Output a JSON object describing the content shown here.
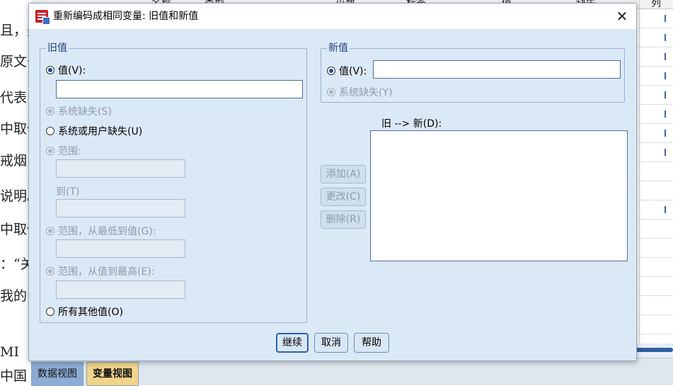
{
  "background": {
    "doc_lines": [
      "且，美",
      "原文书",
      "代表",
      "中取代",
      "戒烟",
      "说明。",
      "中取代",
      "：“关",
      "我的",
      "MI",
      "中国"
    ],
    "grid_headers": [
      "名称",
      "类型",
      "小数",
      "标签",
      "值",
      "缺失",
      "列"
    ],
    "tabs": {
      "data_view": "数据视图",
      "variable_view": "变量视图"
    }
  },
  "dialog": {
    "title": "重新编码成相同变量: 旧值和新值",
    "close_glyph": "✕",
    "old_value": {
      "legend": "旧值",
      "value_label": "值(V):",
      "value_input": "",
      "system_missing": "系统缺失(S)",
      "system_or_user_missing": "系统或用户缺失(U)",
      "range": "范围:",
      "through": "到(T)",
      "range_lowest": "范围，从最低到值(G):",
      "range_highest": "范围，从值到最高(E):",
      "all_other": "所有其他值(O)"
    },
    "new_value": {
      "legend": "新值",
      "value_label": "值(V):",
      "value_input": "",
      "system_missing": "系统缺失(Y)"
    },
    "buttons": {
      "add": "添加(A)",
      "change": "更改(C)",
      "remove": "删除(R)"
    },
    "list_label": "旧 --> 新(D):",
    "footer": {
      "continue": "继续",
      "cancel": "取消",
      "help": "帮助"
    }
  }
}
